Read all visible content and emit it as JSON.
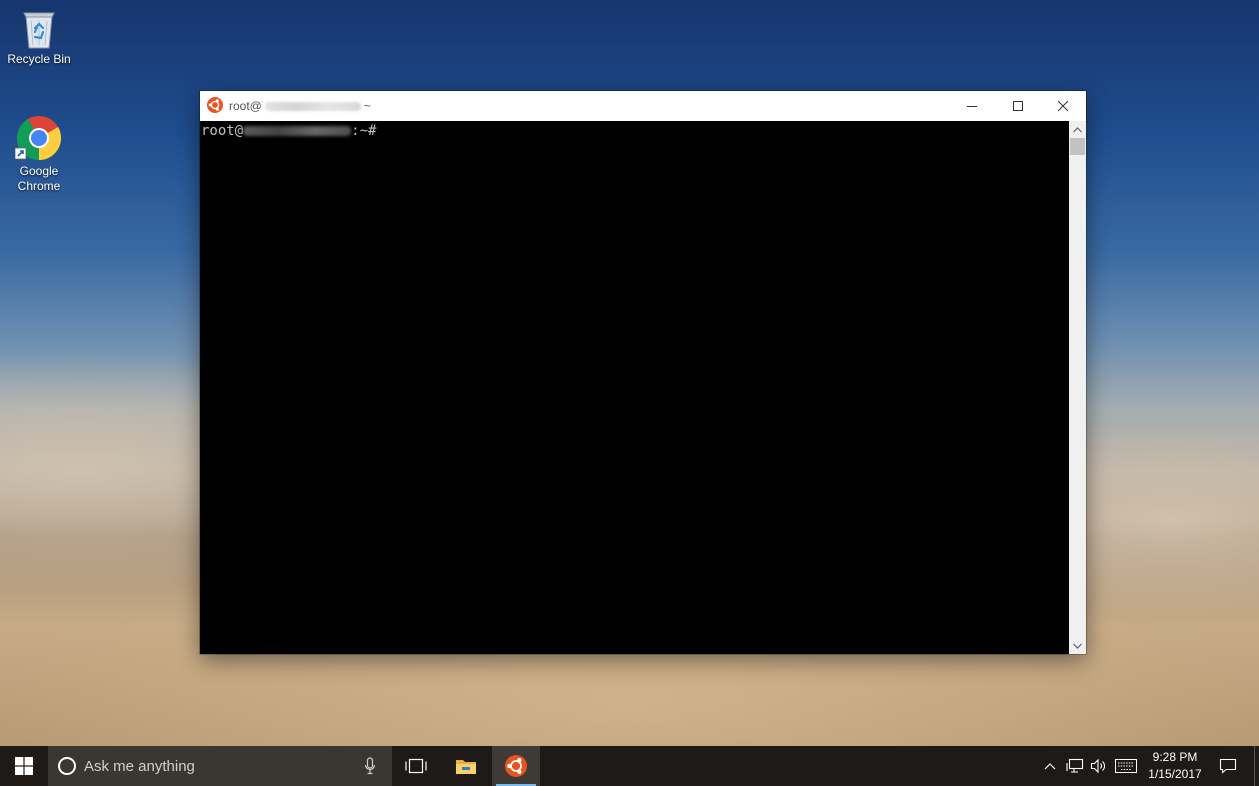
{
  "desktop": {
    "icons": [
      {
        "label": "Recycle Bin",
        "icon": "recycle-bin-icon"
      },
      {
        "label": "Google\nChrome",
        "line1": "Google",
        "line2": "Chrome",
        "icon": "chrome-icon"
      }
    ]
  },
  "window": {
    "title_prefix": "root@",
    "title_suffix": "~",
    "icon": "ubuntu-icon",
    "controls": [
      "minimize-icon",
      "maximize-icon",
      "close-icon"
    ],
    "console": {
      "prompt_user": "root@",
      "prompt_suffix": ":~#"
    }
  },
  "taskbar": {
    "search_placeholder": "Ask me anything",
    "pinned": [
      "task-view-icon",
      "file-explorer-icon",
      "ubuntu-icon"
    ],
    "tray_icons": [
      "chevron-up-icon",
      "network-icon",
      "volume-icon",
      "keyboard-icon",
      "action-center-icon"
    ],
    "clock": {
      "time": "9:28 PM",
      "date": "1/15/2017"
    }
  },
  "colors": {
    "taskbar_bg": "#1d1a17",
    "console_bg": "#000000",
    "ubuntu_orange": "#e95420",
    "accent_underline": "#76b9ed"
  }
}
